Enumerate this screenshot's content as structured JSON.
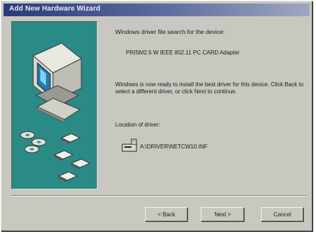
{
  "window": {
    "title": "Add New Hardware Wizard"
  },
  "main": {
    "heading": "Windows driver file search for the device:",
    "device_name": "PRISM2.5 W IEEE 802.11 PC CARD Adapter",
    "ready_text": "Windows is now ready to install the best driver for this device. Click Back to select a different driver, or click Next to continue.",
    "location_label": "Location of driver:",
    "driver_path": "A:\\DRIVER\\NETCW10.INF"
  },
  "buttons": {
    "back": "< Back",
    "next": "Next >",
    "cancel": "Cancel"
  },
  "icons": {
    "wizard_illustration": "computer-with-drivers-icon",
    "driver_file": "floppy-drive-file-icon"
  },
  "colors": {
    "titlebar_start": "#2a3a7a",
    "panel": "#2a8a86",
    "window_face": "#c8c8c0"
  }
}
